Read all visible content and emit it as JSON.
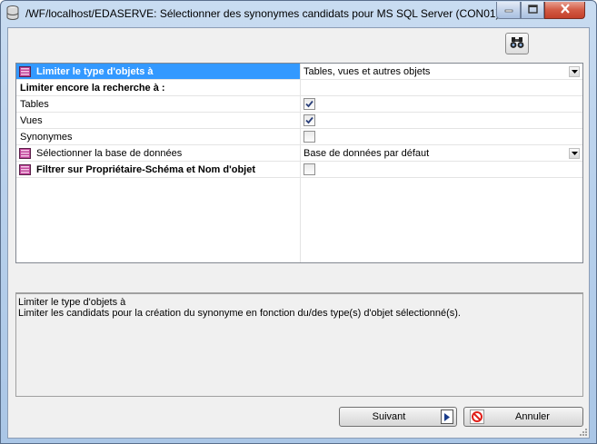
{
  "window": {
    "title": "/WF/localhost/EDASERVE: Sélectionner des synonymes candidats pour MS SQL Server (CON01)"
  },
  "toolbar": {
    "find_icon": "binoculars-icon"
  },
  "properties": {
    "limit_type_label": "Limiter le type d'objets à",
    "limit_type_value": "Tables, vues et autres objets",
    "refine_header": "Limiter encore la recherche à :",
    "tables_label": "Tables",
    "tables_checked": true,
    "views_label": "Vues",
    "views_checked": true,
    "synonyms_label": "Synonymes",
    "synonyms_checked": false,
    "database_label": "Sélectionner la base de données",
    "database_value": "Base de données par défaut",
    "filter_label": "Filtrer sur Propriétaire-Schéma et Nom d'objet",
    "filter_checked": false
  },
  "description": {
    "title": "Limiter le type d'objets à",
    "text": "Limiter les candidats pour la création du synonyme en fonction du/des type(s) d'objet sélectionné(s)."
  },
  "buttons": {
    "next_label": "Suivant",
    "cancel_label": "Annuler"
  },
  "colors": {
    "selection": "#3399ff",
    "close_button": "#c3402a"
  }
}
